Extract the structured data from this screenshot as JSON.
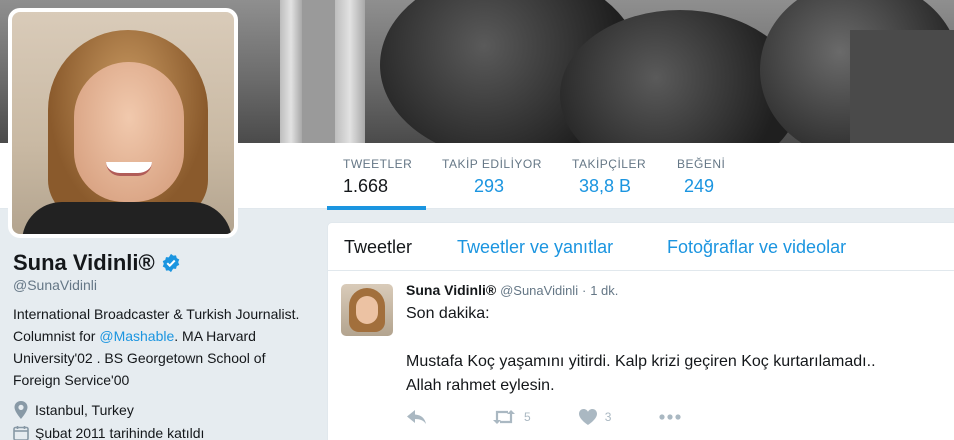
{
  "profile": {
    "name": "Suna Vidinli®",
    "handle": "@SunaVidinli",
    "bio_part1": "International Broadcaster & Turkish Journalist. Columnist for ",
    "bio_link": "@Mashable",
    "bio_part2": ". MA Harvard University'02 . BS Georgetown School of Foreign Service'00",
    "location": "Istanbul, Turkey",
    "joined": "Şubat 2011 tarihinde katıldı"
  },
  "stats": [
    {
      "label": "TWEETLER",
      "value": "1.668"
    },
    {
      "label": "TAKİP EDİLİYOR",
      "value": "293"
    },
    {
      "label": "TAKİPÇİLER",
      "value": "38,8 B"
    },
    {
      "label": "BEĞENİ",
      "value": "249"
    }
  ],
  "tabs": [
    {
      "label": "Tweetler"
    },
    {
      "label": "Tweetler ve yanıtlar"
    },
    {
      "label": "Fotoğraflar ve videolar"
    }
  ],
  "tweet": {
    "name": "Suna Vidinli®",
    "handle": "@SunaVidinli",
    "separator": "·",
    "time": "1 dk.",
    "line1": "Son dakika:",
    "line2": "Mustafa Koç yaşamını yitirdi. Kalp krizi geçiren Koç kurtarılamadı..",
    "line3": "Allah rahmet eylesin.",
    "retweets": "5",
    "likes": "3"
  },
  "colors": {
    "accent": "#1b95e0",
    "muted": "#657786",
    "icon": "#aab8c2"
  }
}
